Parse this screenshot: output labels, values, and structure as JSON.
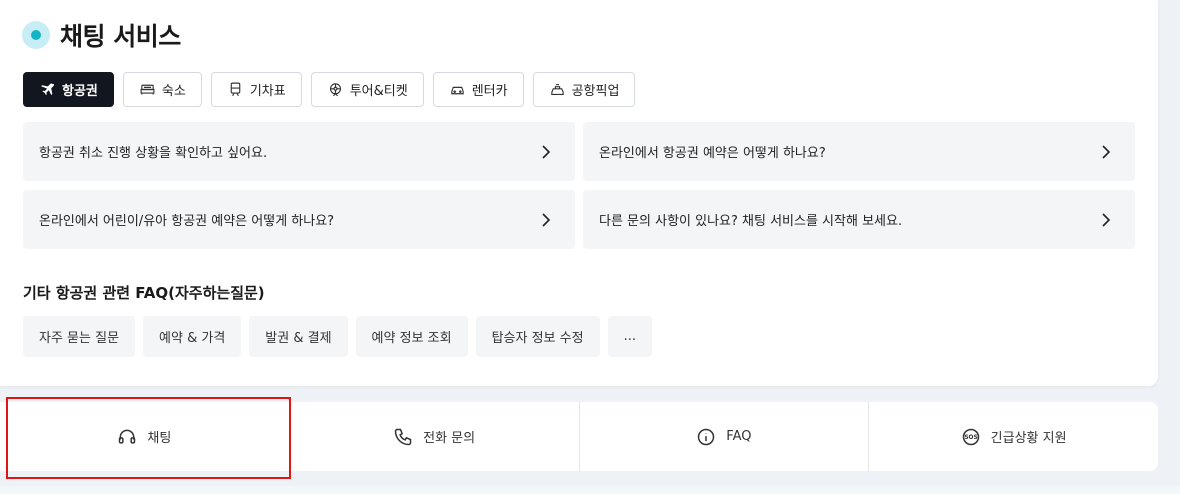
{
  "title": "채팅 서비스",
  "tabs": [
    {
      "label": "항공권",
      "icon": "airplane-icon",
      "active": true
    },
    {
      "label": "숙소",
      "icon": "bed-icon"
    },
    {
      "label": "기차표",
      "icon": "train-icon"
    },
    {
      "label": "투어&티켓",
      "icon": "ferris-wheel-icon"
    },
    {
      "label": "렌터카",
      "icon": "car-icon"
    },
    {
      "label": "공항픽업",
      "icon": "pickup-car-icon"
    }
  ],
  "questions": [
    {
      "text": "항공권 취소 진행 상황을 확인하고 싶어요."
    },
    {
      "text": "온라인에서 항공권 예약은 어떻게 하나요?"
    },
    {
      "text": "온라인에서 어린이/유아 항공권 예약은 어떻게 하나요?"
    },
    {
      "text": "다른 문의 사항이 있나요? 채팅 서비스를 시작해 보세요."
    }
  ],
  "faq": {
    "title": "기타 항공권 관련 FAQ(자주하는질문)",
    "chips": [
      "자주 묻는 질문",
      "예약 & 가격",
      "발권 & 결제",
      "예약 정보 조회",
      "탑승자 정보 수정",
      "..."
    ]
  },
  "bottom": [
    {
      "label": "채팅",
      "icon": "headset-icon"
    },
    {
      "label": "전화 문의",
      "icon": "phone-icon"
    },
    {
      "label": "FAQ",
      "icon": "info-icon"
    },
    {
      "label": "긴급상황 지원",
      "icon": "sos-icon"
    }
  ],
  "colors": {
    "accent": "#14b3c6",
    "active_tab": "#12161f",
    "highlight": "#e21515"
  }
}
